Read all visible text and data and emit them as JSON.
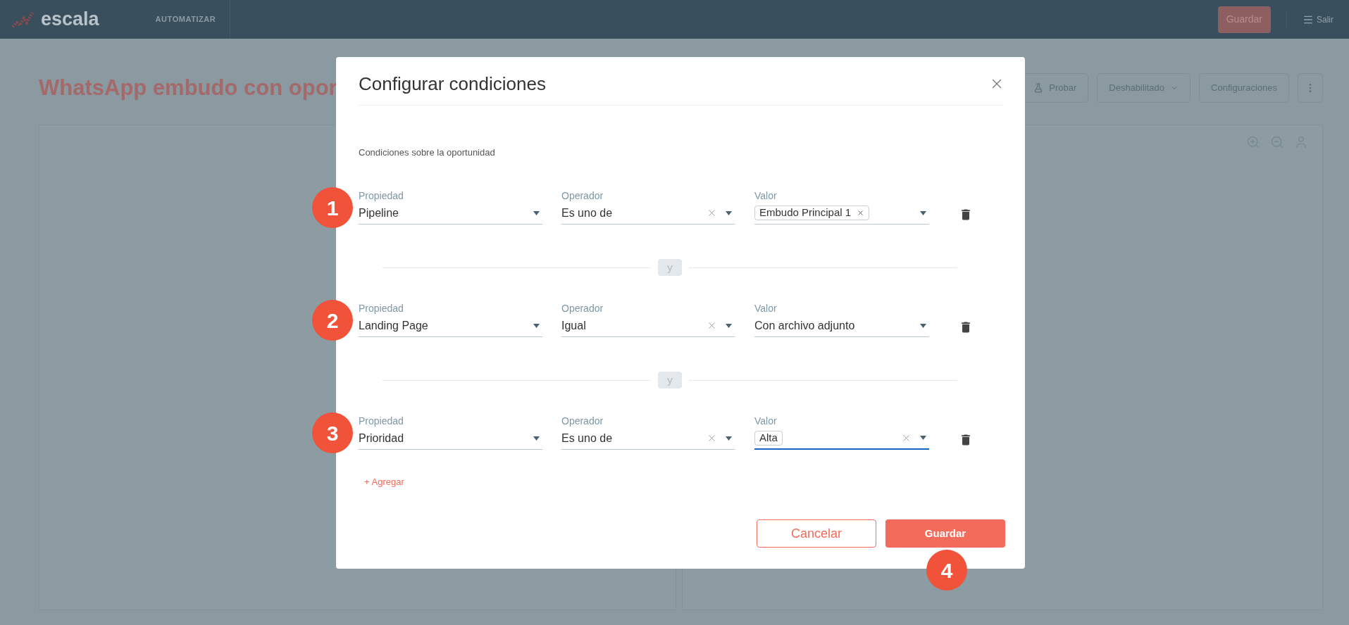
{
  "header": {
    "logo": "escala",
    "nav": "AUTOMATIZAR",
    "save": "Guardar",
    "exit": "Salir"
  },
  "page": {
    "title": "WhatsApp embudo con opor",
    "actions": [
      {
        "label": "Probar",
        "kind": "icon"
      },
      {
        "label": "Deshabilitado",
        "kind": "dropdown"
      },
      {
        "label": "Configuraciones",
        "kind": "plain"
      }
    ]
  },
  "modal": {
    "title": "Configurar condiciones",
    "section_label": "Condiciones sobre la oportunidad",
    "conditions": [
      {
        "step": "1",
        "property": {
          "label": "Propiedad",
          "value": "Pipeline"
        },
        "operator": {
          "label": "Operador",
          "value": "Es uno de",
          "clearable": true
        },
        "value": {
          "label": "Valor",
          "kind": "tag",
          "value": "Embudo Principal 1",
          "clearable": false,
          "focused": false
        }
      },
      {
        "step": "2",
        "connector": "y",
        "property": {
          "label": "Propiedad",
          "value": "Landing Page"
        },
        "operator": {
          "label": "Operador",
          "value": "Igual",
          "clearable": true
        },
        "value": {
          "label": "Valor",
          "kind": "text",
          "value": "Con archivo adjunto",
          "clearable": false,
          "focused": false
        }
      },
      {
        "step": "3",
        "connector": "y",
        "property": {
          "label": "Propiedad",
          "value": "Prioridad"
        },
        "operator": {
          "label": "Operador",
          "value": "Es uno de",
          "clearable": true
        },
        "value": {
          "label": "Valor",
          "kind": "tag",
          "value": "Alta",
          "clearable": true,
          "focused": true
        }
      }
    ],
    "add_label": "+ Agregar",
    "cancel": "Cancelar",
    "save": "Guardar",
    "save_step": "4"
  }
}
